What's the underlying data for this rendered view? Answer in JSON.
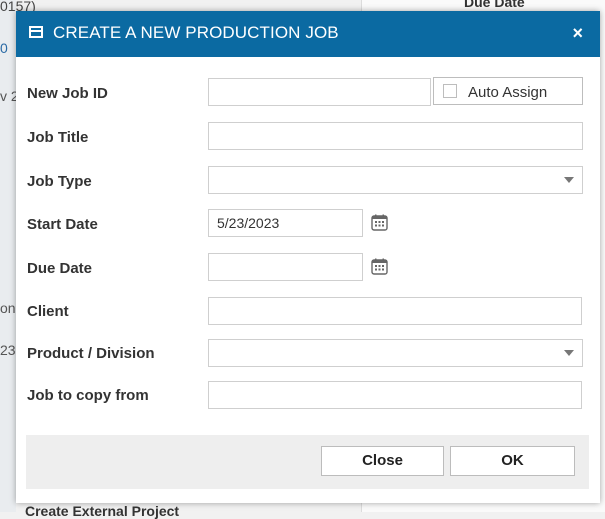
{
  "background": {
    "left_fragments": [
      "0157)",
      "0",
      "v 2",
      "on",
      "23"
    ],
    "right_header": "Due Date",
    "bottom_partial": "Create External Project"
  },
  "dialog": {
    "title": "CREATE A NEW PRODUCTION JOB",
    "close_glyph": "×",
    "fields": {
      "new_job_id": {
        "label": "New Job ID",
        "value": ""
      },
      "auto_assign": {
        "label": "Auto Assign",
        "checked": false
      },
      "job_title": {
        "label": "Job Title",
        "value": ""
      },
      "job_type": {
        "label": "Job Type",
        "value": ""
      },
      "start_date": {
        "label": "Start Date",
        "value": "5/23/2023"
      },
      "due_date": {
        "label": "Due Date",
        "value": ""
      },
      "client": {
        "label": "Client",
        "value": ""
      },
      "product_division": {
        "label": "Product / Division",
        "value": ""
      },
      "job_to_copy_from": {
        "label": "Job to copy from",
        "value": ""
      }
    },
    "buttons": {
      "close": "Close",
      "ok": "OK"
    }
  },
  "colors": {
    "titlebar": "#0b6aa2"
  },
  "icons": [
    "window-icon",
    "close-icon",
    "calendar-icon",
    "chevron-down-icon",
    "checkbox-icon"
  ]
}
